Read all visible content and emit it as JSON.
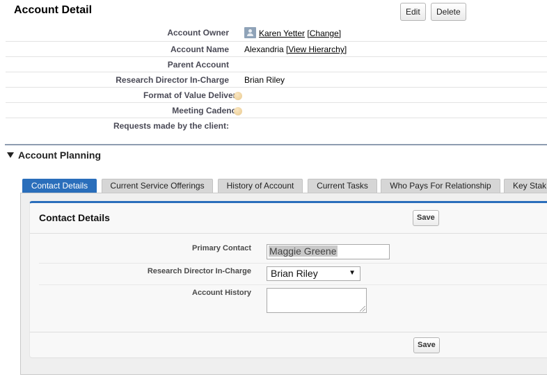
{
  "header": {
    "title": "Account Detail",
    "edit_label": "Edit",
    "delete_label": "Delete"
  },
  "details": [
    {
      "label": "Account Owner",
      "value": "Karen Yetter",
      "link": "[Change]",
      "icon": "user-avatar-icon"
    },
    {
      "label": "Account Name",
      "value": "Alexandria",
      "link": "[View Hierarchy]"
    },
    {
      "label": "Parent Account",
      "value": ""
    },
    {
      "label": "Research Director In-Charge",
      "value": "Brian Riley"
    },
    {
      "label": "Format of Value Delivery",
      "value": "",
      "help": true
    },
    {
      "label": "Meeting Cadence",
      "value": "",
      "help": true
    },
    {
      "label": "Requests made by the client:",
      "value": ""
    }
  ],
  "section": {
    "title": "Account Planning",
    "icon": "triangle-down-icon"
  },
  "tabs": [
    {
      "label": "Contact Details",
      "active": true
    },
    {
      "label": "Current Service Offerings"
    },
    {
      "label": "History of Account"
    },
    {
      "label": "Current Tasks"
    },
    {
      "label": "Who Pays For Relationship"
    },
    {
      "label": "Key Stak"
    }
  ],
  "panel": {
    "title": "Contact Details",
    "save_label": "Save",
    "fields": {
      "primary_contact": {
        "label": "Primary Contact",
        "value": "Maggie Greene"
      },
      "research_director": {
        "label": "Research Director In-Charge",
        "value": "Brian Riley"
      },
      "account_history": {
        "label": "Account History",
        "value": ""
      }
    }
  },
  "colors": {
    "accent": "#2a6ebb",
    "section_rule": "#8e9cb0"
  }
}
